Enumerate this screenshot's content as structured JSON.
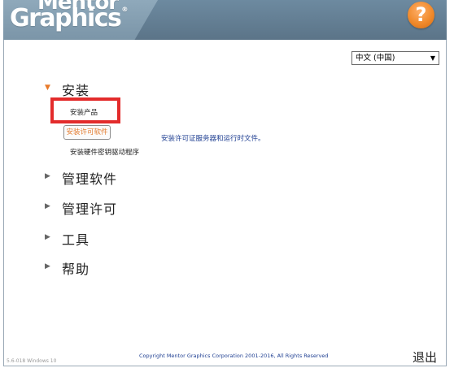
{
  "header": {
    "logo_line1": "Mentor",
    "logo_line2": "Graphics",
    "logo_reg": "®",
    "help_label": "?"
  },
  "language": {
    "selected": "中文 (中国)",
    "arrow": "▼"
  },
  "nav": {
    "install": {
      "label": "安装",
      "expanded": true,
      "sub_items": [
        "安装产品",
        "安装许可软件",
        "安装硬件密钥驱动程序"
      ]
    },
    "manage_software": {
      "label": "管理软件"
    },
    "manage_license": {
      "label": "管理许可"
    },
    "tools": {
      "label": "工具"
    },
    "help": {
      "label": "帮助"
    }
  },
  "description": "安装许可证服务器和运行时文件。",
  "footer": {
    "version": "5.6-018  Windows 10",
    "copyright": "Copyright Mentor Graphics Corporation 2001-2016, All Rights Reserved",
    "exit_label": "退出"
  },
  "colors": {
    "accent": "#e87a2a",
    "link_blue": "#1f3f92",
    "highlight_red": "#e32b2b",
    "header_blue": "#6d8aa0"
  }
}
